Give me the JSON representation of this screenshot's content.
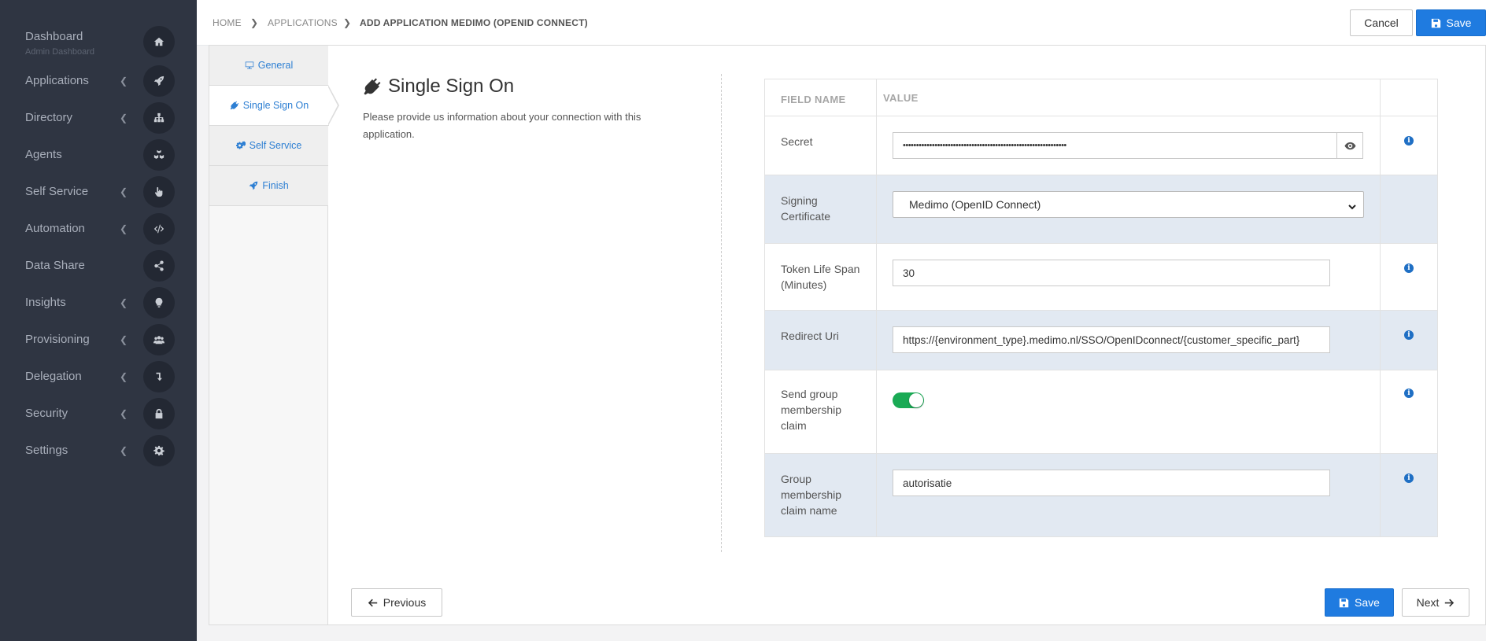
{
  "sidebar": {
    "dashboard": {
      "label": "Dashboard",
      "sublabel": "Admin Dashboard",
      "icon": "home-icon"
    },
    "items": [
      {
        "label": "Applications",
        "icon": "rocket-icon",
        "has_chevron": true
      },
      {
        "label": "Directory",
        "icon": "sitemap-icon",
        "has_chevron": true
      },
      {
        "label": "Agents",
        "icon": "cubes-icon",
        "has_chevron": false
      },
      {
        "label": "Self Service",
        "icon": "hand-pointer-icon",
        "has_chevron": true
      },
      {
        "label": "Automation",
        "icon": "code-icon",
        "has_chevron": true
      },
      {
        "label": "Data Share",
        "icon": "share-icon",
        "has_chevron": false
      },
      {
        "label": "Insights",
        "icon": "lightbulb-icon",
        "has_chevron": true
      },
      {
        "label": "Provisioning",
        "icon": "users-icon",
        "has_chevron": true
      },
      {
        "label": "Delegation",
        "icon": "level-down-icon",
        "has_chevron": true
      },
      {
        "label": "Security",
        "icon": "lock-icon",
        "has_chevron": true
      },
      {
        "label": "Settings",
        "icon": "gear-icon",
        "has_chevron": true
      }
    ]
  },
  "breadcrumb": {
    "home": "HOME",
    "applications": "APPLICATIONS",
    "current": "ADD APPLICATION MEDIMO (OPENID CONNECT)"
  },
  "toolbar": {
    "cancel_label": "Cancel",
    "save_label": "Save"
  },
  "wizard_tabs": [
    {
      "label": "General",
      "icon": "desktop-icon"
    },
    {
      "label": "Single Sign On",
      "icon": "plug-icon",
      "active": true
    },
    {
      "label": "Self Service",
      "icon": "cogs-icon"
    },
    {
      "label": "Finish",
      "icon": "rocket-icon"
    }
  ],
  "section": {
    "title": "Single Sign On",
    "description": "Please provide us information about your connection with this application."
  },
  "table": {
    "headers": {
      "field_name": "FIELD NAME",
      "value": "VALUE"
    },
    "secret": {
      "label": "Secret",
      "value": "••••••••••••••••••••••••••••••••••••••••••••••••••••••••••••••"
    },
    "signing_certificate": {
      "label": "Signing Certificate",
      "selected": "Medimo (OpenID Connect)"
    },
    "token_life_span": {
      "label": "Token Life Span (Minutes)",
      "value": "30"
    },
    "redirect_uri": {
      "label": "Redirect Uri",
      "value": "https://{environment_type}.medimo.nl/SSO/OpenIDconnect/{customer_specific_part}"
    },
    "send_group_claim": {
      "label": "Send group membership claim",
      "enabled": true
    },
    "group_claim_name": {
      "label": "Group membership claim name",
      "value": "autorisatie"
    }
  },
  "footer": {
    "previous_label": "Previous",
    "save_label": "Save",
    "next_label": "Next"
  },
  "colors": {
    "sidebar_bg": "#2f3542",
    "primary": "#1f7be0",
    "row_alt": "#e2e9f2",
    "toggle_on": "#1aaa55"
  }
}
